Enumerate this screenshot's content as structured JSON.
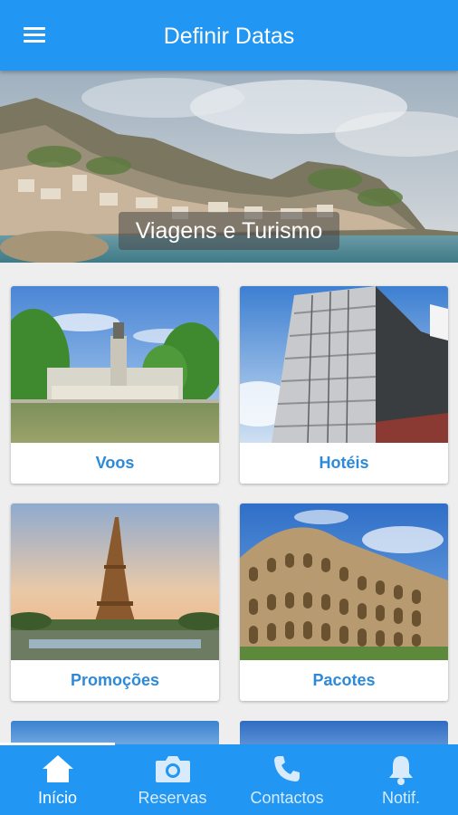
{
  "appbar": {
    "title": "Definir Datas",
    "menu_icon": "hamburger-icon"
  },
  "hero": {
    "caption": "Viagens e Turismo"
  },
  "cards": [
    {
      "label": "Voos"
    },
    {
      "label": "Hotéis"
    },
    {
      "label": "Promoções"
    },
    {
      "label": "Pacotes"
    }
  ],
  "bottom_nav": {
    "items": [
      {
        "label": "Início",
        "icon": "home-icon",
        "active": true
      },
      {
        "label": "Reservas",
        "icon": "camera-icon"
      },
      {
        "label": "Contactos",
        "icon": "phone-icon"
      },
      {
        "label": "Notif.",
        "icon": "bell-icon"
      }
    ]
  },
  "colors": {
    "primary": "#2196f3",
    "card_label": "#2d8ad9",
    "background": "#eeeeee"
  }
}
